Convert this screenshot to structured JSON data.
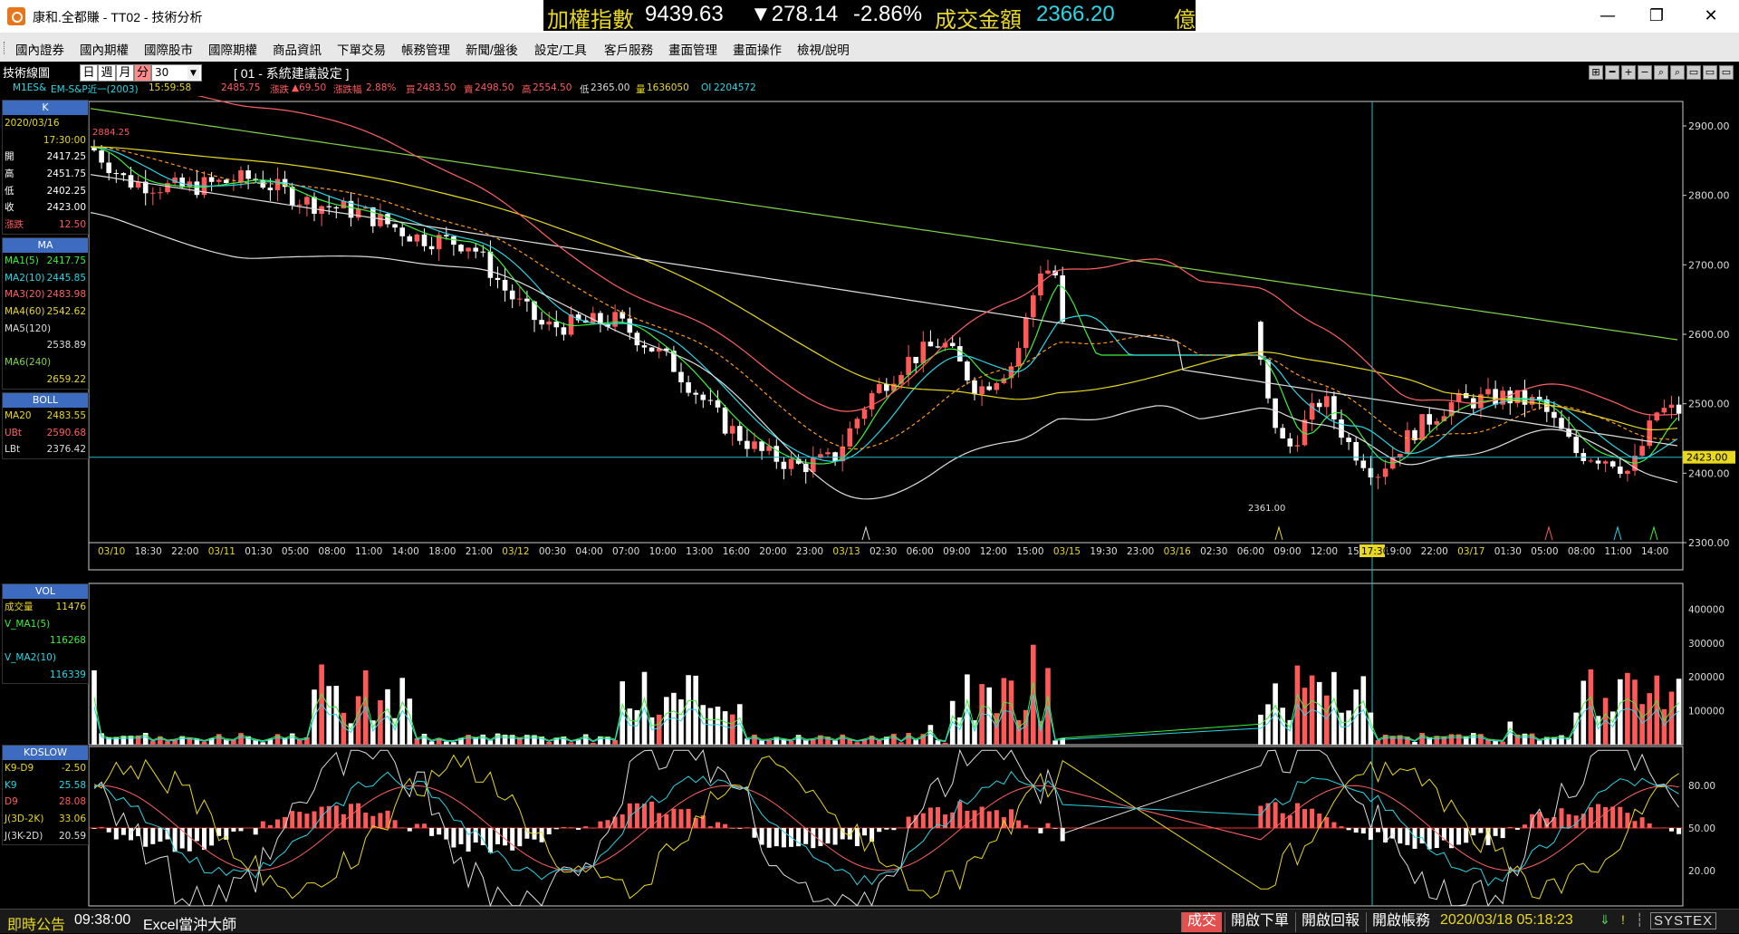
{
  "window": {
    "title": "康和.全都賺 - TT02 - 技術分析",
    "minimize": "—",
    "maximize": "❐",
    "close": "✕"
  },
  "ticker": {
    "label": "加權指數",
    "index": "9439.63",
    "change": "▼278.14",
    "change_pct": "-2.86%",
    "turnover_label": "成交金額",
    "turnover": "2366.20",
    "unit": "億"
  },
  "menu": [
    "國內證券",
    "國內期權",
    "國際股市",
    "國際期權",
    "商品資訊",
    "下單交易",
    "帳務管理",
    "新聞/盤後",
    "設定/工具",
    "客戶服務",
    "畫面管理",
    "畫面操作",
    "檢視/說明"
  ],
  "panel": {
    "title": "技術線圖",
    "periods": [
      "日",
      "週",
      "月",
      "分"
    ],
    "period_active": "分",
    "interval": "30",
    "interval_arrow": "▼",
    "preset": "[ 01 - 系統建議設定 ]",
    "tools": [
      "⊞",
      "━",
      "+",
      "−",
      "⌕",
      "⌕",
      "▭",
      "▭",
      "▭",
      "▭"
    ]
  },
  "quote": {
    "symbol": "M1ES&",
    "name": "EM-S&P近一(2003)",
    "time": "15:59:58",
    "last": "2485.75",
    "change_label": "漲跌",
    "change": "▲69.50",
    "pct_label": "漲跌幅",
    "pct": "2.88%",
    "bid_label": "買",
    "bid": "2483.50",
    "ask_label": "賣",
    "ask": "2498.50",
    "high_label": "高",
    "high": "2554.50",
    "low_label": "低",
    "low": "2365.00",
    "vol_label": "量",
    "vol": "1636050",
    "oi_label": "OI",
    "oi": "2204572"
  },
  "info_k": {
    "header": "K",
    "date": "2020/03/16",
    "time": "17:30:00",
    "rows": [
      {
        "k": "開",
        "v": "2417.25"
      },
      {
        "k": "高",
        "v": "2451.75"
      },
      {
        "k": "低",
        "v": "2402.25"
      },
      {
        "k": "收",
        "v": "2423.00"
      },
      {
        "k": "漲跌",
        "v": "12.50"
      }
    ]
  },
  "info_ma": {
    "header": "MA",
    "rows": [
      {
        "k": "MA1(5)",
        "v": "2417.75"
      },
      {
        "k": "MA2(10)",
        "v": "2445.85"
      },
      {
        "k": "MA3(20)",
        "v": "2483.98"
      },
      {
        "k": "MA4(60)",
        "v": "2542.62"
      },
      {
        "k": "MA5(120)",
        "v": ""
      },
      {
        "k": "",
        "v": "2538.89"
      },
      {
        "k": "MA6(240)",
        "v": ""
      },
      {
        "k": "",
        "v": "2659.22"
      }
    ]
  },
  "info_boll": {
    "header": "BOLL",
    "rows": [
      {
        "k": "MA20",
        "v": "2483.55"
      },
      {
        "k": "UBt",
        "v": "2590.68"
      },
      {
        "k": "LBt",
        "v": "2376.42"
      }
    ]
  },
  "info_vol": {
    "header": "VOL",
    "rows": [
      {
        "k": "成交量",
        "v": "11476"
      },
      {
        "k": "V_MA1(5)",
        "v": ""
      },
      {
        "k": "",
        "v": "116268"
      },
      {
        "k": "V_MA2(10)",
        "v": ""
      },
      {
        "k": "",
        "v": "116339"
      }
    ]
  },
  "info_kd": {
    "header": "KDSLOW",
    "rows": [
      {
        "k": "K9-D9",
        "v": "-2.50"
      },
      {
        "k": "K9",
        "v": "25.58"
      },
      {
        "k": "D9",
        "v": "28.08"
      },
      {
        "k": "J(3D-2K)",
        "v": "33.06"
      },
      {
        "k": "J(3K-2D)",
        "v": "20.59"
      }
    ]
  },
  "price_axis": [
    "2900.00",
    "2800.00",
    "2700.00",
    "2600.00",
    "2500.00",
    "2400.00",
    "2300.00"
  ],
  "price_marker": "2423.00",
  "high_label": "2884.25",
  "low_label": "2361.00",
  "cursor_time": "17:30",
  "time_axis": [
    "03/10",
    "18:30",
    "22:00",
    "03/11",
    "01:30",
    "05:00",
    "08:00",
    "11:00",
    "14:00",
    "18:00",
    "21:00",
    "03/12",
    "00:30",
    "04:00",
    "07:00",
    "10:00",
    "13:00",
    "16:00",
    "20:00",
    "23:00",
    "03/13",
    "02:30",
    "06:00",
    "09:00",
    "12:00",
    "15:00",
    "03/15",
    "19:30",
    "23:00",
    "03/16",
    "02:30",
    "06:00",
    "09:00",
    "12:00",
    "15:00",
    "19:00",
    "22:00",
    "03/17",
    "01:30",
    "05:00",
    "08:00",
    "11:00",
    "14:00"
  ],
  "vol_axis": [
    "400000",
    "300000",
    "200000",
    "100000"
  ],
  "kd_axis": [
    "80.00",
    "50.00",
    "20.00"
  ],
  "status": {
    "news_label": "即時公告",
    "news_time": "09:38:00",
    "news_text": "Excel當沖大師",
    "btn_deal": "成交",
    "btn_order": "開啟下單",
    "btn_report": "開啟回報",
    "btn_account": "開啟帳務",
    "datetime": "2020/03/18 05:18:23",
    "brand": "SYSTEX"
  },
  "colors": {
    "up": "#ff5a5a",
    "down": "#ffffff",
    "ma5": "#3cf03c",
    "ma10": "#28d7e6",
    "ma20": "#ff6060",
    "ma60": "#ff9a1c",
    "ma120": "#dddddd",
    "ma240": "#7fd44a",
    "ma_yellow": "#e8d820",
    "cursor": "#2ab8c8",
    "panel_header": "#3c6bc0"
  }
}
